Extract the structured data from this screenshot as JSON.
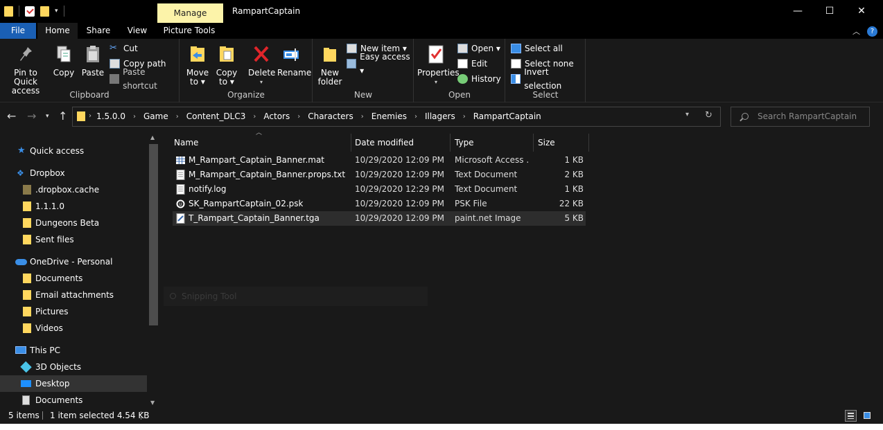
{
  "titlebar": {
    "manage_tab": "Manage",
    "title": "RampartCaptain",
    "minimize": "—",
    "maximize": "☐",
    "close": "✕"
  },
  "tabs": {
    "file": "File",
    "home": "Home",
    "share": "Share",
    "view": "View",
    "picture_tools": "Picture Tools",
    "help": "?"
  },
  "ribbon": {
    "clipboard": {
      "pin_line1": "Pin to Quick",
      "pin_line2": "access",
      "copy": "Copy",
      "paste": "Paste",
      "cut": "Cut",
      "copy_path": "Copy path",
      "paste_shortcut": "Paste shortcut",
      "label": "Clipboard"
    },
    "organize": {
      "move_line1": "Move",
      "move_line2": "to ▾",
      "copy_line1": "Copy",
      "copy_line2": "to ▾",
      "delete": "Delete",
      "rename": "Rename",
      "label": "Organize"
    },
    "new": {
      "new_folder_line1": "New",
      "new_folder_line2": "folder",
      "new_item": "New item ▾",
      "easy_access": "Easy access ▾",
      "label": "New"
    },
    "open": {
      "properties": "Properties",
      "open": "Open ▾",
      "edit": "Edit",
      "history": "History",
      "label": "Open"
    },
    "select": {
      "select_all": "Select all",
      "select_none": "Select none",
      "invert": "Invert selection",
      "label": "Select"
    }
  },
  "address": {
    "crumbs": [
      "1.5.0.0",
      "Game",
      "Content_DLC3",
      "Actors",
      "Characters",
      "Enemies",
      "Illagers",
      "RampartCaptain"
    ],
    "search_placeholder": "Search RampartCaptain"
  },
  "nav": {
    "items": [
      {
        "label": "Quick access",
        "icon": "star-icon"
      },
      {
        "label": "Dropbox",
        "icon": "dropbox-icon"
      },
      {
        "label": ".dropbox.cache",
        "icon": "folder-icon"
      },
      {
        "label": "1.1.1.0",
        "icon": "folder-icon"
      },
      {
        "label": "Dungeons Beta",
        "icon": "folder-icon"
      },
      {
        "label": "Sent files",
        "icon": "folder-icon"
      },
      {
        "label": "OneDrive - Personal",
        "icon": "cloud-icon"
      },
      {
        "label": "Documents",
        "icon": "folder-icon"
      },
      {
        "label": "Email attachments",
        "icon": "folder-icon"
      },
      {
        "label": "Pictures",
        "icon": "folder-icon"
      },
      {
        "label": "Videos",
        "icon": "folder-icon"
      },
      {
        "label": "This PC",
        "icon": "pc-icon"
      },
      {
        "label": "3D Objects",
        "icon": "cube-icon"
      },
      {
        "label": "Desktop",
        "icon": "desktop-icon"
      },
      {
        "label": "Documents",
        "icon": "document-icon"
      }
    ]
  },
  "columns": {
    "name": "Name",
    "date": "Date modified",
    "type": "Type",
    "size": "Size"
  },
  "files": [
    {
      "name": "M_Rampart_Captain_Banner.mat",
      "date": "10/29/2020 12:09 PM",
      "type": "Microsoft Access ...",
      "size": "1 KB",
      "icon": "table-file-icon"
    },
    {
      "name": "M_Rampart_Captain_Banner.props.txt",
      "date": "10/29/2020 12:09 PM",
      "type": "Text Document",
      "size": "2 KB",
      "icon": "text-file-icon"
    },
    {
      "name": "notify.log",
      "date": "10/29/2020 12:29 PM",
      "type": "Text Document",
      "size": "1 KB",
      "icon": "text-file-icon"
    },
    {
      "name": "SK_RampartCaptain_02.psk",
      "date": "10/29/2020 12:09 PM",
      "type": "PSK File",
      "size": "22 KB",
      "icon": "unreal-file-icon"
    },
    {
      "name": "T_Rampart_Captain_Banner.tga",
      "date": "10/29/2020 12:09 PM",
      "type": "paint.net Image",
      "size": "5 KB",
      "icon": "image-file-icon"
    }
  ],
  "ghost_text": "Snipping Tool",
  "status": {
    "count": "5 items",
    "selected": "1 item selected  4.54 KB"
  },
  "colors": {
    "accent": "#1a5fb4",
    "manage_tab": "#fcf3a9",
    "folder": "#ffd75e"
  }
}
